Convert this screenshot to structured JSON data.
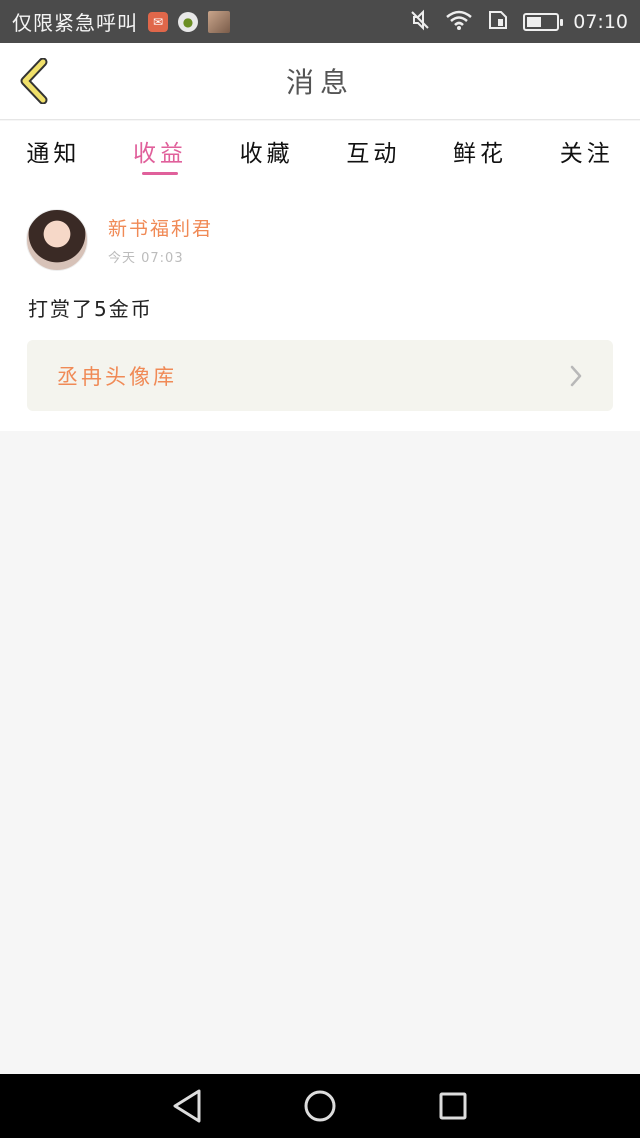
{
  "status_bar": {
    "carrier_text": "仅限紧急呼叫",
    "time": "07:10",
    "icons": [
      "mail-notification-icon",
      "chat-notification-icon",
      "photo-notification-icon",
      "mute-icon",
      "wifi-icon",
      "sim-icon",
      "battery-icon"
    ]
  },
  "header": {
    "title": "消息",
    "back_icon": "chevron-left-icon"
  },
  "tabs": [
    {
      "label": "通知",
      "active": false
    },
    {
      "label": "收益",
      "active": true
    },
    {
      "label": "收藏",
      "active": false
    },
    {
      "label": "互动",
      "active": false
    },
    {
      "label": "鲜花",
      "active": false
    },
    {
      "label": "关注",
      "active": false
    }
  ],
  "message": {
    "sender": "新书福利君",
    "time": "今天 07:03",
    "text": "打赏了5金币",
    "link_label": "丞冉头像库"
  },
  "colors": {
    "accent_pink": "#e0609b",
    "accent_orange": "#f08a56",
    "back_icon_yellow": "#f0e06a"
  },
  "nav_bar": {
    "icons": [
      "back-triangle-icon",
      "home-circle-icon",
      "recents-square-icon"
    ]
  }
}
